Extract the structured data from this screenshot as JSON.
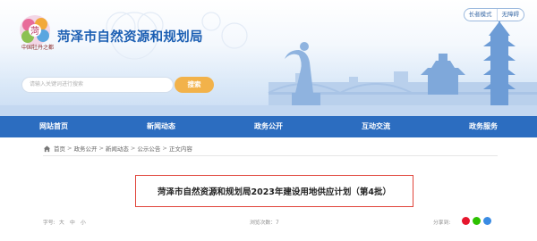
{
  "header": {
    "site_title": "菏泽市自然资源和规划局",
    "logo_caption": "中国牡丹之都",
    "logo_glyph": "菏",
    "accessibility": {
      "elderly_mode": "长者模式",
      "barrier_free": "无障碍"
    },
    "search": {
      "placeholder": "请输入关键词进行搜索",
      "button_label": "搜索"
    }
  },
  "nav": {
    "items": [
      {
        "label": "网站首页"
      },
      {
        "label": "新闻动态"
      },
      {
        "label": "政务公开"
      },
      {
        "label": "互动交流"
      },
      {
        "label": "政务服务"
      }
    ]
  },
  "breadcrumb": {
    "items": [
      "首页",
      "政务公开",
      "新闻动态",
      "公示公告",
      "正文内容"
    ],
    "separator": ">"
  },
  "article": {
    "title": "菏泽市自然资源和规划局2023年建设用地供应计划（第4批）"
  },
  "meta": {
    "font_label": "字号:",
    "font_sizes": [
      "大",
      "中",
      "小"
    ],
    "views_label": "浏览次数：7",
    "share_label": "分享到:"
  },
  "colors": {
    "brand_blue": "#2c6dc0",
    "title_blue": "#1c5fb3",
    "search_orange": "#f2b24a",
    "highlight_red": "#e0443a"
  },
  "icons": [
    "home-icon",
    "weibo-icon",
    "wechat-icon",
    "qq-icon"
  ]
}
